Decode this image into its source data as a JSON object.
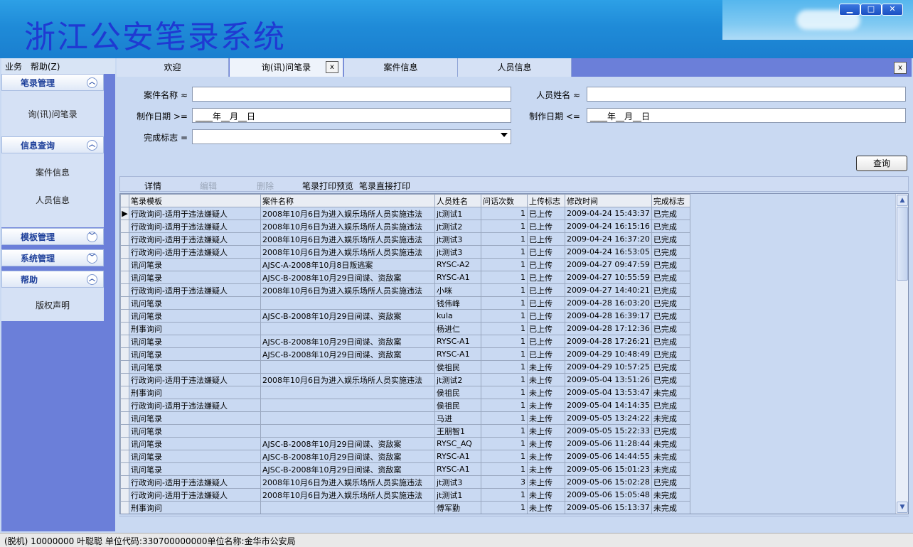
{
  "app": {
    "title": "浙江公安笔录系统"
  },
  "window_controls": {
    "minimize": "▁",
    "maximize": "□",
    "close": "✕"
  },
  "menu": {
    "items": [
      "业务",
      "帮助(Z)"
    ]
  },
  "sidebar": {
    "groups": [
      {
        "title": "笔录管理",
        "items": [
          "询(讯)问笔录"
        ]
      },
      {
        "title": "信息查询",
        "items": [
          "案件信息",
          "人员信息"
        ]
      },
      {
        "title": "模板管理",
        "items": []
      },
      {
        "title": "系统管理",
        "items": []
      },
      {
        "title": "帮助",
        "items": [
          "版权声明"
        ]
      }
    ]
  },
  "tabs": [
    {
      "label": "欢迎"
    },
    {
      "label": "询(讯)问笔录"
    },
    {
      "label": "案件信息"
    },
    {
      "label": "人员信息"
    }
  ],
  "tab_close": "x",
  "filter": {
    "case_name_label": "案件名称 ≈",
    "person_name_label": "人员姓名 ≈",
    "date_from_label": "制作日期 >=",
    "date_to_label": "制作日期 <=",
    "date_from_value": "____年__月__日",
    "date_to_value": "____年__月__日",
    "status_label": "完成标志 ="
  },
  "query_button": "查询",
  "toolbar": {
    "detail": "详情",
    "edit": "编辑",
    "delete": "删除",
    "print_preview": "笔录打印预览",
    "print_direct": "笔录直接打印"
  },
  "grid": {
    "columns": [
      "笔录模板",
      "案件名称",
      "人员姓名",
      "问话次数",
      "上传标志",
      "修改时间",
      "完成标志"
    ],
    "rows": [
      [
        "行政询问-适用于违法嫌疑人",
        "2008年10月6日为进入娱乐场所人员实施违法",
        "jt测试1",
        "1",
        "已上传",
        "2009-04-24 15:43:37",
        "已完成"
      ],
      [
        "行政询问-适用于违法嫌疑人",
        "2008年10月6日为进入娱乐场所人员实施违法",
        "jt测试2",
        "1",
        "已上传",
        "2009-04-24 16:15:16",
        "已完成"
      ],
      [
        "行政询问-适用于违法嫌疑人",
        "2008年10月6日为进入娱乐场所人员实施违法",
        "jt测试3",
        "1",
        "已上传",
        "2009-04-24 16:37:20",
        "已完成"
      ],
      [
        "行政询问-适用于违法嫌疑人",
        "2008年10月6日为进入娱乐场所人员实施违法",
        "jt测试3",
        "1",
        "已上传",
        "2009-04-24 16:53:05",
        "已完成"
      ],
      [
        "讯问笔录",
        "AJSC-A-2008年10月8日叛逃案",
        "RYSC-A2",
        "1",
        "已上传",
        "2009-04-27 09:47:59",
        "已完成"
      ],
      [
        "讯问笔录",
        "AJSC-B-2008年10月29日间谍、资敌案",
        "RYSC-A1",
        "1",
        "已上传",
        "2009-04-27 10:55:59",
        "已完成"
      ],
      [
        "行政询问-适用于违法嫌疑人",
        "2008年10月6日为进入娱乐场所人员实施违法",
        "小咪",
        "1",
        "已上传",
        "2009-04-27 14:40:21",
        "已完成"
      ],
      [
        "讯问笔录",
        "",
        "钱伟峰",
        "1",
        "已上传",
        "2009-04-28 16:03:20",
        "已完成"
      ],
      [
        "讯问笔录",
        "AJSC-B-2008年10月29日间谍、资敌案",
        "kula",
        "1",
        "已上传",
        "2009-04-28 16:39:17",
        "已完成"
      ],
      [
        "刑事询问",
        "",
        "杨进仁",
        "1",
        "已上传",
        "2009-04-28 17:12:36",
        "已完成"
      ],
      [
        "讯问笔录",
        "AJSC-B-2008年10月29日间谍、资敌案",
        "RYSC-A1",
        "1",
        "已上传",
        "2009-04-28 17:26:21",
        "已完成"
      ],
      [
        "讯问笔录",
        "AJSC-B-2008年10月29日间谍、资敌案",
        "RYSC-A1",
        "1",
        "已上传",
        "2009-04-29 10:48:49",
        "已完成"
      ],
      [
        "讯问笔录",
        "",
        "侯祖民",
        "1",
        "未上传",
        "2009-04-29 10:57:25",
        "已完成"
      ],
      [
        "行政询问-适用于违法嫌疑人",
        "2008年10月6日为进入娱乐场所人员实施违法",
        "jt测试2",
        "1",
        "未上传",
        "2009-05-04 13:51:26",
        "已完成"
      ],
      [
        "刑事询问",
        "",
        "侯祖民",
        "1",
        "未上传",
        "2009-05-04 13:53:47",
        "未完成"
      ],
      [
        "行政询问-适用于违法嫌疑人",
        "",
        "侯祖民",
        "1",
        "未上传",
        "2009-05-04 14:14:35",
        "已完成"
      ],
      [
        "讯问笔录",
        "",
        "马进",
        "1",
        "未上传",
        "2009-05-05 13:24:22",
        "未完成"
      ],
      [
        "讯问笔录",
        "",
        "王朋智1",
        "1",
        "未上传",
        "2009-05-05 15:22:33",
        "已完成"
      ],
      [
        "讯问笔录",
        "AJSC-B-2008年10月29日间谍、资敌案",
        "RYSC_AQ",
        "1",
        "未上传",
        "2009-05-06 11:28:44",
        "未完成"
      ],
      [
        "讯问笔录",
        "AJSC-B-2008年10月29日间谍、资敌案",
        "RYSC-A1",
        "1",
        "未上传",
        "2009-05-06 14:44:55",
        "未完成"
      ],
      [
        "讯问笔录",
        "AJSC-B-2008年10月29日间谍、资敌案",
        "RYSC-A1",
        "1",
        "未上传",
        "2009-05-06 15:01:23",
        "未完成"
      ],
      [
        "行政询问-适用于违法嫌疑人",
        "2008年10月6日为进入娱乐场所人员实施违法",
        "jt测试3",
        "3",
        "未上传",
        "2009-05-06 15:02:28",
        "已完成"
      ],
      [
        "行政询问-适用于违法嫌疑人",
        "2008年10月6日为进入娱乐场所人员实施违法",
        "jt测试1",
        "1",
        "未上传",
        "2009-05-06 15:05:48",
        "未完成"
      ],
      [
        "刑事询问",
        "",
        "傅军勤",
        "1",
        "未上传",
        "2009-05-06 15:13:37",
        "未完成"
      ]
    ]
  },
  "status_bar": "(脱机) 10000000 叶聪聪 单位代码:330700000000单位名称:金华市公安局"
}
